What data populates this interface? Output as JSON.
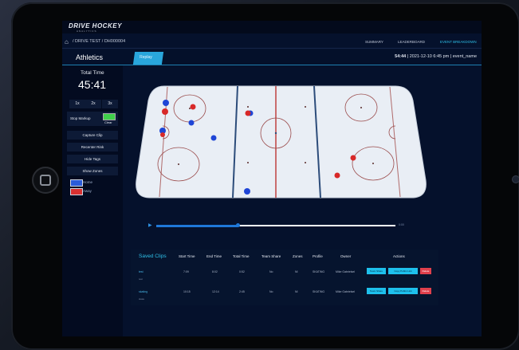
{
  "header": {
    "logo": "DRIVE HOCKEY",
    "logo_sub": "ANALYTICS"
  },
  "nav": {
    "breadcrumb": "/ DRIVE TEST / DH000004",
    "links": [
      "SUMMARY",
      "LEADERBOARD",
      "EVENT BREAKDOWN"
    ],
    "active_link": "EVENT BREAKDOWN"
  },
  "titlebar": {
    "title": "Athletics",
    "tab": "Replay",
    "event_time": "54:44",
    "event_info": "| 2021-12-10 6:45 pm | event_name"
  },
  "sidebar": {
    "total_time_label": "Total Time",
    "total_time_value": "45:41",
    "speeds": [
      "1x",
      "2x",
      "3x"
    ],
    "stop_markup": "Stop Markup",
    "clear": "Clear",
    "buttons": [
      "Capture Clip",
      "Recenter Rink",
      "Hide Tags",
      "Show Zones"
    ],
    "legend": [
      {
        "label": "Home",
        "color": "#2a5bd8"
      },
      {
        "label": "Away",
        "color": "#d83030"
      }
    ]
  },
  "colors": {
    "home": "#1f45d6",
    "away": "#d82828",
    "accent": "#2ec0e8"
  },
  "timeline": {
    "progress": 0.34,
    "time": "0:00"
  },
  "saved_clips": {
    "title": "Saved Clips",
    "columns": [
      "Start Time",
      "End Time",
      "Total Time",
      "Team Share",
      "Zones",
      "Profile",
      "Owner",
      "Actions"
    ],
    "rows": [
      {
        "name": "test",
        "sub": "test",
        "start": "7:09",
        "end": "8:02",
        "total": "0:52",
        "share": "No",
        "zones": "NI",
        "profile": "SKATING",
        "owner": "Mike Gabrielsel",
        "actions": [
          "Team Share",
          "Copy Public Link",
          "Delete"
        ]
      },
      {
        "name": "skating",
        "sub": "skate",
        "start": "10:15",
        "end": "12:14",
        "total": "2:45",
        "share": "No",
        "zones": "NI",
        "profile": "SKATING",
        "owner": "Mike Gabrielsel",
        "actions": [
          "Team Share",
          "Copy Public Link",
          "Delete"
        ]
      }
    ]
  }
}
